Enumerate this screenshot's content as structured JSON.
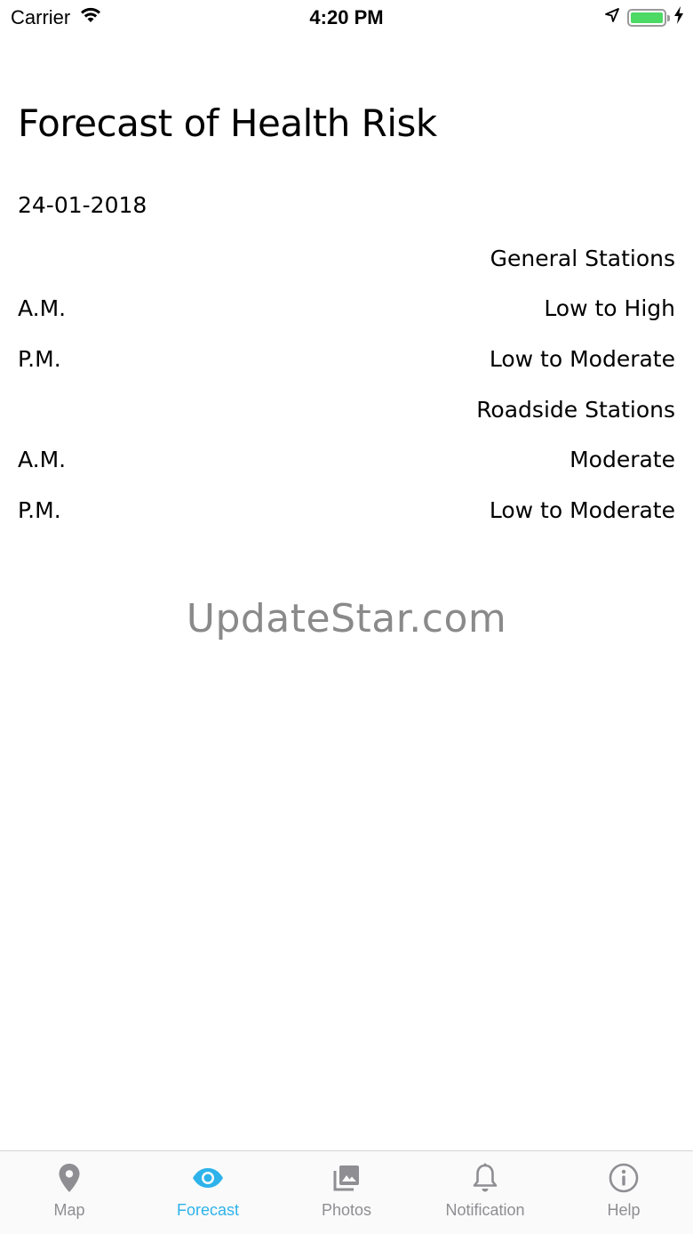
{
  "status_bar": {
    "carrier": "Carrier",
    "time": "4:20 PM",
    "battery_level": 1.0,
    "battery_color": "#4cd964"
  },
  "page": {
    "title": "Forecast of Health Risk",
    "date": "24-01-2018",
    "rows": [
      {
        "left": "",
        "right": "General Stations"
      },
      {
        "left": "A.M.",
        "right": "Low to High"
      },
      {
        "left": "P.M.",
        "right": "Low to Moderate"
      },
      {
        "left": "",
        "right": "Roadside Stations"
      },
      {
        "left": "A.M.",
        "right": "Moderate"
      },
      {
        "left": "P.M.",
        "right": "Low to Moderate"
      }
    ]
  },
  "watermark": "UpdateStar.com",
  "tab_bar": {
    "active_color": "#2db3ea",
    "inactive_color": "#8e8e93",
    "tabs": [
      {
        "label": "Map",
        "icon": "map-pin-icon",
        "active": false
      },
      {
        "label": "Forecast",
        "icon": "eye-icon",
        "active": true
      },
      {
        "label": "Photos",
        "icon": "photos-icon",
        "active": false
      },
      {
        "label": "Notification",
        "icon": "bell-icon",
        "active": false
      },
      {
        "label": "Help",
        "icon": "info-icon",
        "active": false
      }
    ]
  }
}
